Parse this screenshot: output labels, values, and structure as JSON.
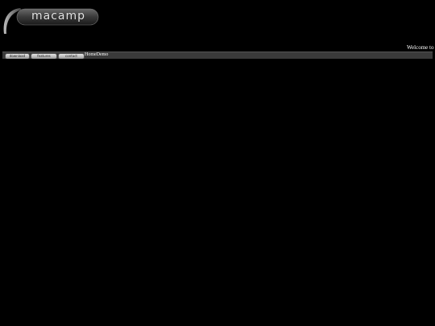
{
  "header": {
    "logo_text": "macamp"
  },
  "welcome_text": "Welcome to",
  "nav": {
    "buttons": [
      {
        "label": "download"
      },
      {
        "label": "features"
      },
      {
        "label": "contact"
      }
    ],
    "links": [
      {
        "label": "Home"
      },
      {
        "label": "Demo"
      }
    ]
  },
  "colors": {
    "background": "#000000",
    "navbar": "#3a3a3a"
  }
}
